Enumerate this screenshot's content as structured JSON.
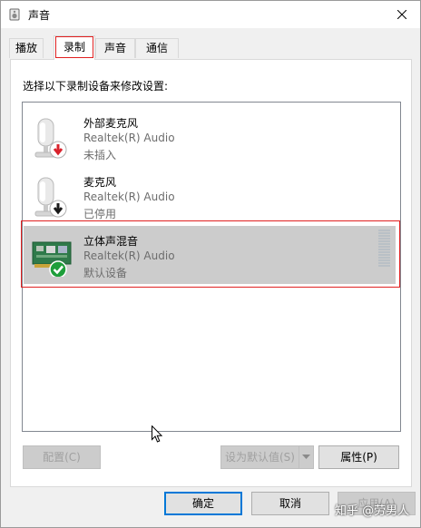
{
  "window": {
    "title": "声音",
    "icon": "speaker-icon",
    "close_icon": "close-icon"
  },
  "tabs": [
    {
      "label": "播放",
      "active": false
    },
    {
      "label": "录制",
      "active": true
    },
    {
      "label": "声音",
      "active": false
    },
    {
      "label": "通信",
      "active": false
    }
  ],
  "instruction": "选择以下录制设备来修改设置:",
  "devices": [
    {
      "name": "外部麦克风",
      "driver": "Realtek(R) Audio",
      "status": "未插入",
      "icon": "microphone-icon",
      "badge": "red-down-arrow-icon",
      "selected": false
    },
    {
      "name": "麦克风",
      "driver": "Realtek(R) Audio",
      "status": "已停用",
      "icon": "microphone-icon",
      "badge": "black-down-arrow-icon",
      "selected": false
    },
    {
      "name": "立体声混音",
      "driver": "Realtek(R) Audio",
      "status": "默认设备",
      "icon": "sound-card-icon",
      "badge": "green-check-icon",
      "selected": true
    }
  ],
  "buttons": {
    "configure": "配置(C)",
    "set_default": "设为默认值(S)",
    "properties": "属性(P)",
    "ok": "确定",
    "cancel": "取消",
    "apply": "应用(A)"
  },
  "watermark": "知乎 @劳男人",
  "colors": {
    "selection": "#cccccc",
    "highlight_box": "#e02020",
    "default_button_border": "#0078d7",
    "check_green": "#1e9e3a",
    "arrow_red": "#d9232d"
  }
}
